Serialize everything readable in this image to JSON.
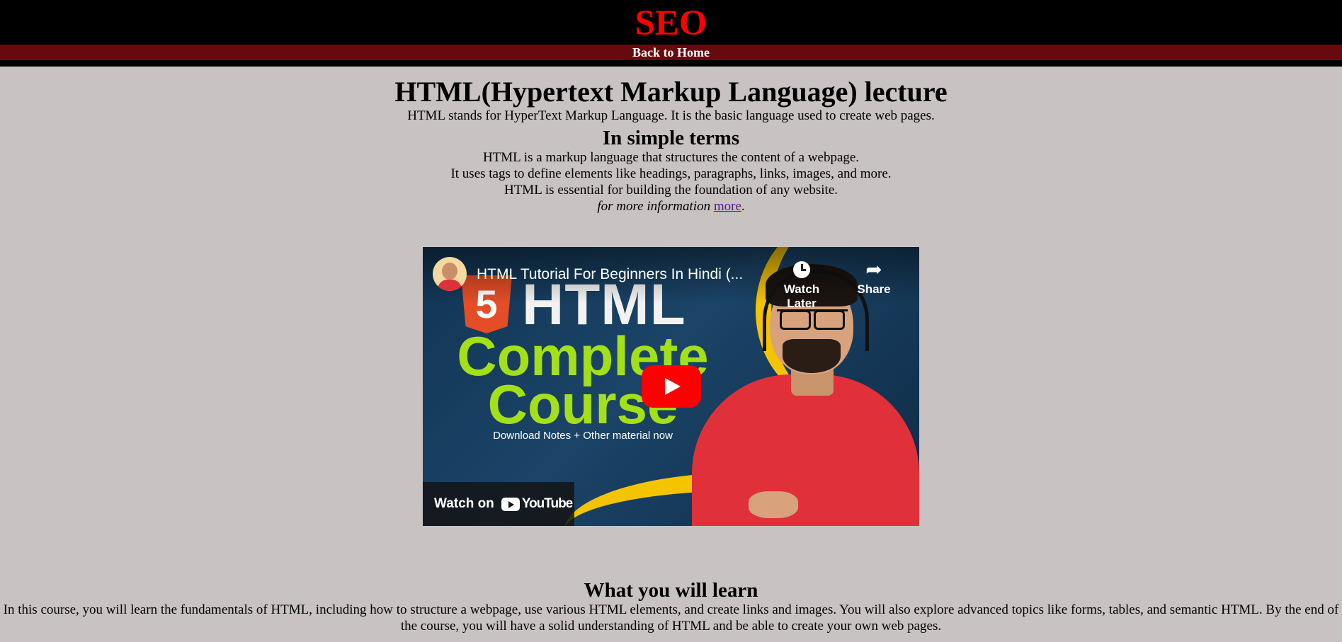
{
  "header": {
    "site_title": "SEO",
    "nav_link": "Back to Home"
  },
  "main": {
    "title": "HTML(Hypertext Markup Language) lecture",
    "intro": "HTML stands for HyperText Markup Language. It is the basic language used to create web pages.",
    "simple_heading": "In simple terms",
    "simple_lines": [
      "HTML is a markup language that structures the content of a webpage.",
      "It uses tags to define elements like headings, paragraphs, links, images, and more.",
      "HTML is essential for building the foundation of any website."
    ],
    "more_prefix": "for more information",
    "more_link": "more",
    "more_suffix": "."
  },
  "video": {
    "title": "HTML Tutorial For Beginners In Hindi (...",
    "watch_later": "Watch Later",
    "share": "Share",
    "watch_on": "Watch on",
    "youtube": "YouTube",
    "thumbnail": {
      "badge": "5",
      "html": "HTML",
      "line1": "Complete",
      "line2": "Course",
      "notes": "Download Notes + Other material now"
    }
  },
  "learn": {
    "heading": "What you will learn",
    "text": "In this course, you will learn the fundamentals of HTML, including how to structure a webpage, use various HTML elements, and create links and images. You will also explore advanced topics like forms, tables, and semantic HTML. By the end of the course, you will have a solid understanding of HTML and be able to create your own web pages."
  },
  "colors": {
    "page_bg": "#c9c2c2",
    "header_bg": "#000000",
    "title_red": "#ff0000",
    "nav_bg": "#670a0e",
    "link_visited": "#551a8b",
    "youtube_red": "#ff0000"
  }
}
